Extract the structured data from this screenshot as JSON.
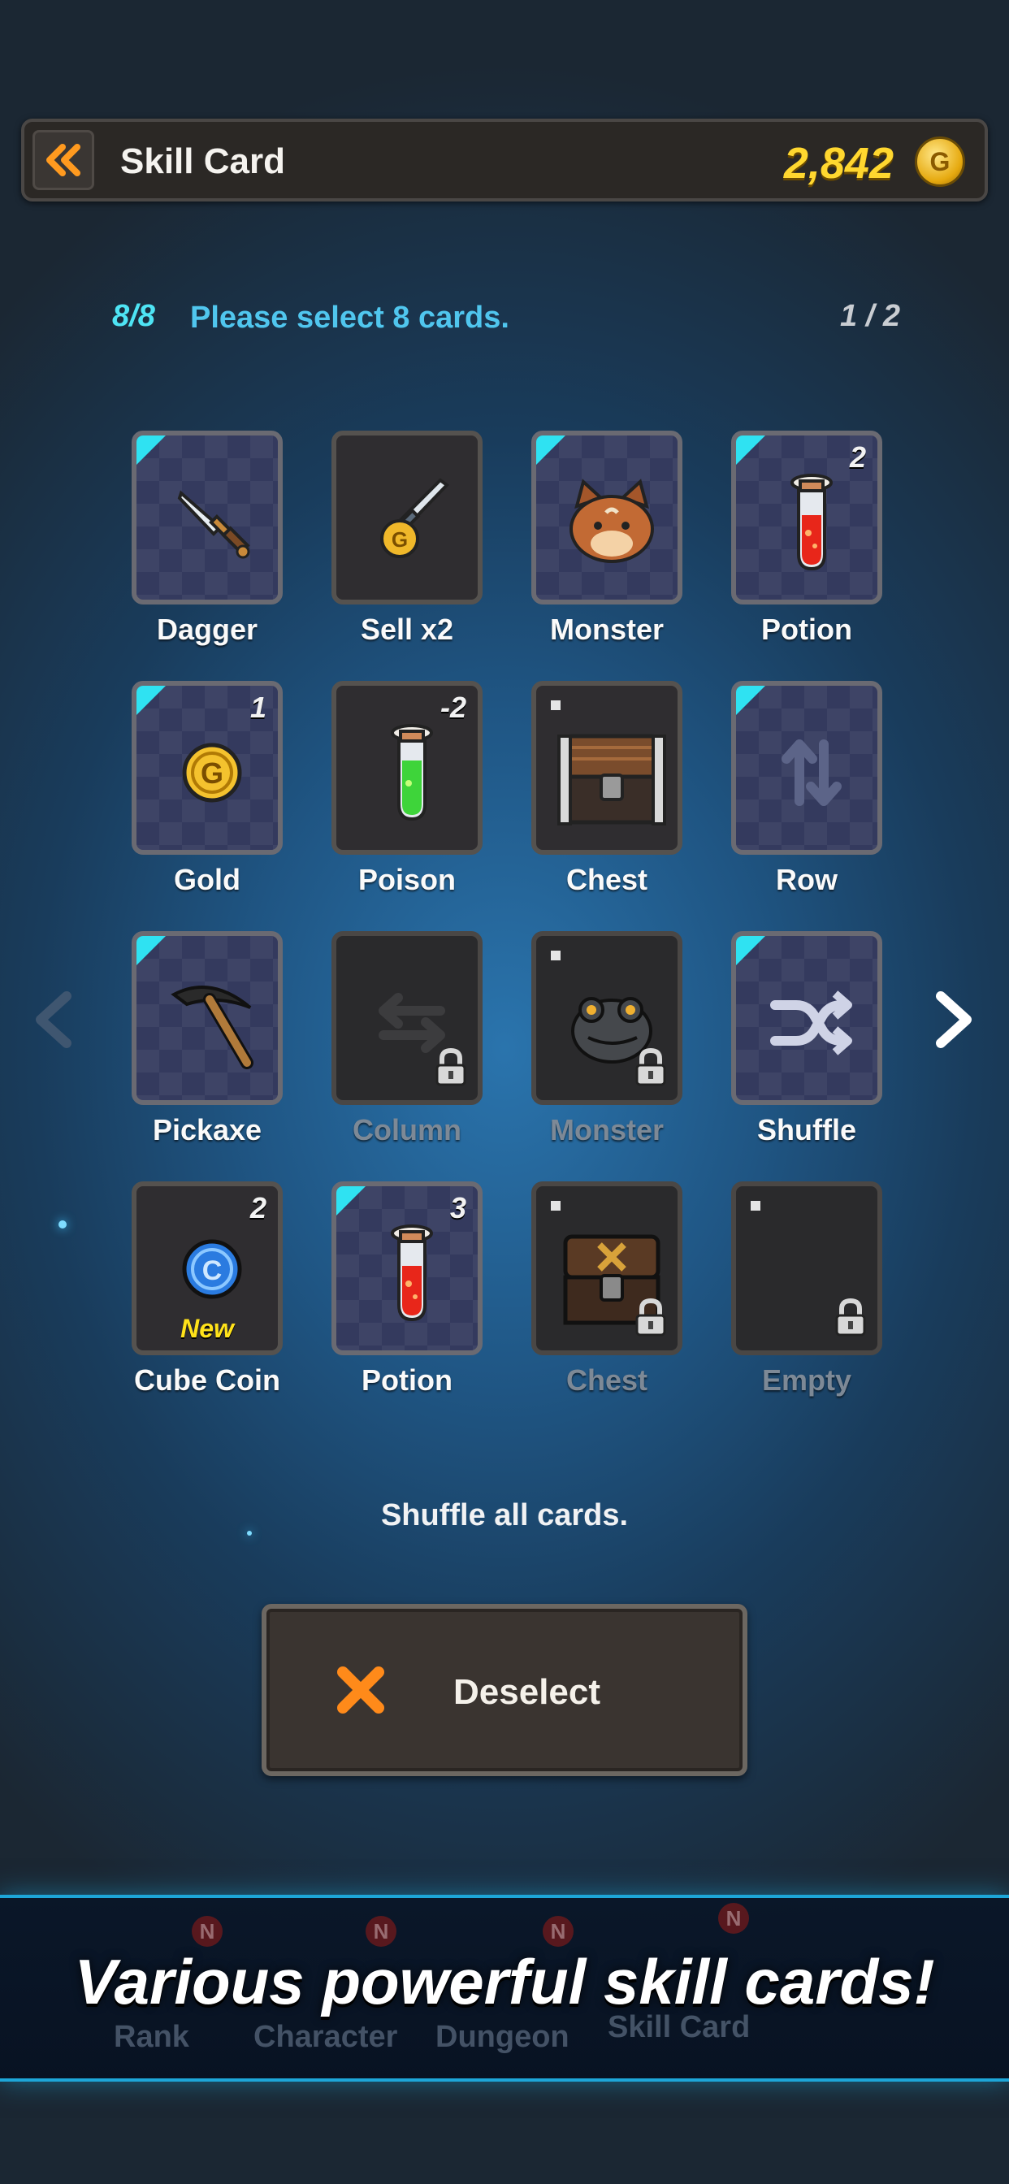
{
  "header": {
    "title": "Skill Card",
    "gold": "2,842",
    "gold_symbol": "G"
  },
  "selection": {
    "count": "8/8",
    "instruction": "Please select 8 cards.",
    "page": "1 / 2"
  },
  "cards": [
    {
      "label": "Dagger",
      "icon": "dagger-icon",
      "selected": true
    },
    {
      "label": "Sell x2",
      "icon": "sword-coin-icon",
      "selected": false
    },
    {
      "label": "Monster",
      "icon": "fox-monster-icon",
      "selected": true
    },
    {
      "label": "Potion",
      "icon": "red-potion-icon",
      "selected": true,
      "qty": "2"
    },
    {
      "label": "Gold",
      "icon": "gold-coin-icon",
      "selected": true,
      "qty": "1"
    },
    {
      "label": "Poison",
      "icon": "green-potion-icon",
      "selected": false,
      "qty": "-2"
    },
    {
      "label": "Chest",
      "icon": "chest-icon",
      "selected": false
    },
    {
      "label": "Row",
      "icon": "swap-vertical-icon",
      "selected": true
    },
    {
      "label": "Pickaxe",
      "icon": "pickaxe-icon",
      "selected": true
    },
    {
      "label": "Column",
      "icon": "swap-horizontal-icon",
      "locked": true
    },
    {
      "label": "Monster",
      "icon": "frog-monster-icon",
      "locked": true
    },
    {
      "label": "Shuffle",
      "icon": "shuffle-icon",
      "selected": true
    },
    {
      "label": "Cube Coin",
      "icon": "cube-coin-icon",
      "selected": false,
      "qty": "2",
      "badge": "New"
    },
    {
      "label": "Potion",
      "icon": "red-potion-icon",
      "selected": true,
      "qty": "3"
    },
    {
      "label": "Chest",
      "icon": "locked-chest-icon",
      "locked": true
    },
    {
      "label": "Empty",
      "icon": "empty-icon",
      "locked": true
    }
  ],
  "description": "Shuffle all cards.",
  "deselect_button": {
    "label": "Deselect"
  },
  "bottom_nav": {
    "items": [
      "Rank",
      "Character",
      "Dungeon",
      "Skill Card"
    ],
    "badge": "N"
  },
  "banner": "Various powerful skill cards!",
  "colors": {
    "accent_cyan": "#2fe2f2",
    "gold": "#ffd72f",
    "orange": "#ff8a1a"
  }
}
